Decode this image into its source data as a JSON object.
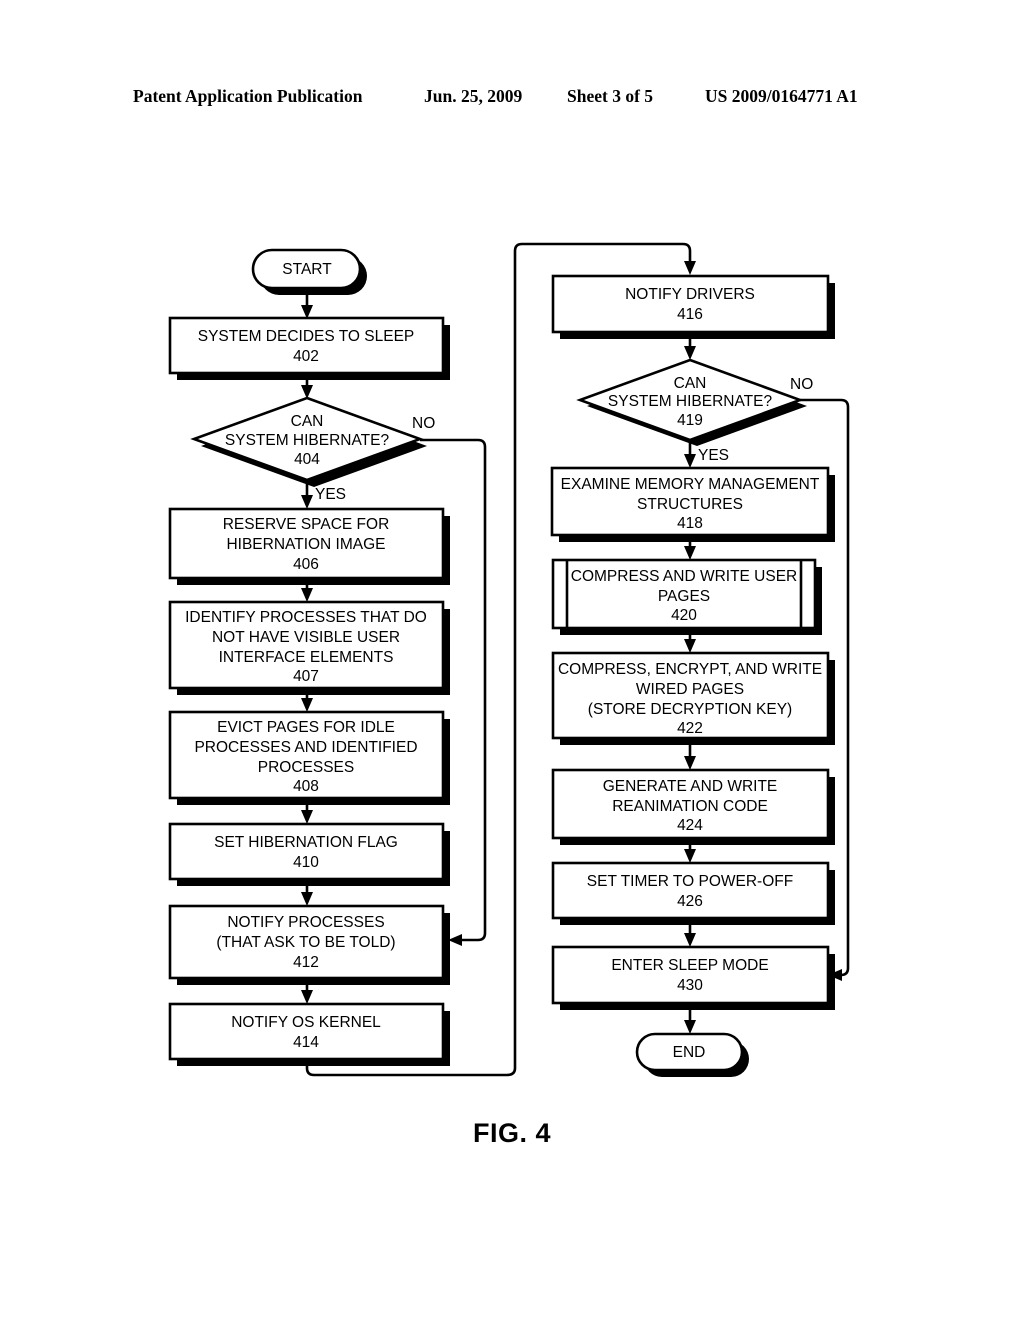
{
  "header": {
    "publication": "Patent Application Publication",
    "date": "Jun. 25, 2009",
    "sheet": "Sheet 3 of 5",
    "patent_number": "US 2009/0164771 A1"
  },
  "figure": {
    "caption": "FIG. 4"
  },
  "flowchart": {
    "left_column": {
      "start_terminal": "START",
      "nodes": [
        {
          "id": "402",
          "type": "process",
          "lines": [
            "SYSTEM DECIDES TO SLEEP"
          ],
          "ref": "402"
        },
        {
          "id": "404",
          "type": "decision",
          "lines": [
            "CAN",
            "SYSTEM HIBERNATE?"
          ],
          "ref": "404",
          "yes_label": "YES",
          "no_label": "NO"
        },
        {
          "id": "406",
          "type": "process",
          "lines": [
            "RESERVE SPACE FOR",
            "HIBERNATION IMAGE"
          ],
          "ref": "406"
        },
        {
          "id": "407",
          "type": "process",
          "lines": [
            "IDENTIFY PROCESSES THAT DO",
            "NOT HAVE VISIBLE USER",
            "INTERFACE ELEMENTS"
          ],
          "ref": "407"
        },
        {
          "id": "408",
          "type": "process",
          "lines": [
            "EVICT PAGES FOR IDLE",
            "PROCESSES AND IDENTIFIED",
            "PROCESSES"
          ],
          "ref": "408"
        },
        {
          "id": "410",
          "type": "process",
          "lines": [
            "SET HIBERNATION FLAG"
          ],
          "ref": "410"
        },
        {
          "id": "412",
          "type": "process",
          "lines": [
            "NOTIFY PROCESSES",
            "(THAT ASK TO BE TOLD)"
          ],
          "ref": "412"
        },
        {
          "id": "414",
          "type": "process",
          "lines": [
            "NOTIFY OS KERNEL"
          ],
          "ref": "414"
        }
      ]
    },
    "right_column": {
      "end_terminal": "END",
      "nodes": [
        {
          "id": "416",
          "type": "process",
          "lines": [
            "NOTIFY DRIVERS"
          ],
          "ref": "416"
        },
        {
          "id": "419",
          "type": "decision",
          "lines": [
            "CAN",
            "SYSTEM HIBERNATE?"
          ],
          "ref": "419",
          "yes_label": "YES",
          "no_label": "NO"
        },
        {
          "id": "418",
          "type": "process",
          "lines": [
            "EXAMINE MEMORY MANAGEMENT",
            "STRUCTURES"
          ],
          "ref": "418"
        },
        {
          "id": "420",
          "type": "predefined-process",
          "lines": [
            "COMPRESS AND WRITE USER",
            "PAGES"
          ],
          "ref": "420"
        },
        {
          "id": "422",
          "type": "process",
          "lines": [
            "COMPRESS, ENCRYPT, AND WRITE",
            "WIRED PAGES",
            "(STORE DECRYPTION KEY)"
          ],
          "ref": "422"
        },
        {
          "id": "424",
          "type": "process",
          "lines": [
            "GENERATE AND WRITE",
            "REANIMATION CODE"
          ],
          "ref": "424"
        },
        {
          "id": "426",
          "type": "process",
          "lines": [
            "SET TIMER TO POWER-OFF"
          ],
          "ref": "426"
        },
        {
          "id": "430",
          "type": "process",
          "lines": [
            "ENTER SLEEP MODE"
          ],
          "ref": "430"
        }
      ]
    }
  },
  "text": {
    "start": "START",
    "end": "END",
    "yes": "YES",
    "no": "NO",
    "n402_l1": "SYSTEM DECIDES TO SLEEP",
    "n402_ref": "402",
    "n404_l1": "CAN",
    "n404_l2": "SYSTEM HIBERNATE?",
    "n404_ref": "404",
    "n404_yes": "YES",
    "n404_no": "NO",
    "n406_l1": "RESERVE SPACE FOR",
    "n406_l2": "HIBERNATION IMAGE",
    "n406_ref": "406",
    "n407_l1": "IDENTIFY PROCESSES THAT DO",
    "n407_l2": "NOT HAVE VISIBLE USER",
    "n407_l3": "INTERFACE ELEMENTS",
    "n407_ref": "407",
    "n408_l1": "EVICT PAGES FOR IDLE",
    "n408_l2": "PROCESSES AND IDENTIFIED",
    "n408_l3": "PROCESSES",
    "n408_ref": "408",
    "n410_l1": "SET HIBERNATION FLAG",
    "n410_ref": "410",
    "n412_l1": "NOTIFY PROCESSES",
    "n412_l2": "(THAT ASK TO BE TOLD)",
    "n412_ref": "412",
    "n414_l1": "NOTIFY OS KERNEL",
    "n414_ref": "414",
    "n416_l1": "NOTIFY DRIVERS",
    "n416_ref": "416",
    "n419_l1": "CAN",
    "n419_l2": "SYSTEM HIBERNATE?",
    "n419_ref": "419",
    "n419_yes": "YES",
    "n419_no": "NO",
    "n418_l1": "EXAMINE MEMORY MANAGEMENT",
    "n418_l2": "STRUCTURES",
    "n418_ref": "418",
    "n420_l1": "COMPRESS AND WRITE USER",
    "n420_l2": "PAGES",
    "n420_ref": "420",
    "n422_l1": "COMPRESS, ENCRYPT, AND WRITE",
    "n422_l2": "WIRED PAGES",
    "n422_l3": "(STORE DECRYPTION KEY)",
    "n422_ref": "422",
    "n424_l1": "GENERATE AND WRITE",
    "n424_l2": "REANIMATION CODE",
    "n424_ref": "424",
    "n426_l1": "SET TIMER TO POWER-OFF",
    "n426_ref": "426",
    "n430_l1": "ENTER SLEEP MODE",
    "n430_ref": "430"
  },
  "colors": {
    "ink": "#000000",
    "paper": "#ffffff"
  }
}
